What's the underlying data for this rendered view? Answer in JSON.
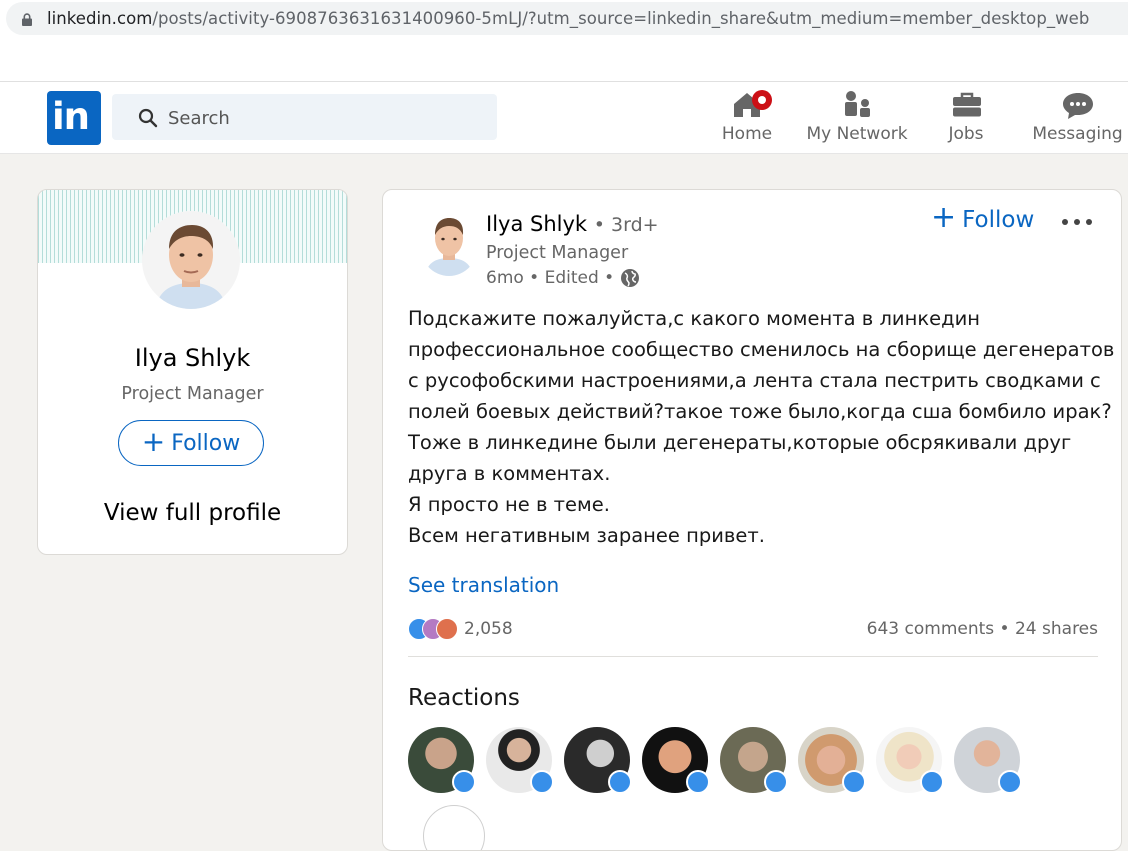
{
  "browser": {
    "url_host": "linkedin.com",
    "url_rest": "/posts/activity-6908763631631400960-5mLJ/?utm_source=linkedin_share&utm_medium=member_desktop_web"
  },
  "header": {
    "logo_text": "in",
    "search_placeholder": "Search",
    "nav": [
      {
        "label": "Home",
        "icon": "home-icon"
      },
      {
        "label": "My Network",
        "icon": "network-icon"
      },
      {
        "label": "Jobs",
        "icon": "briefcase-icon"
      },
      {
        "label": "Messaging",
        "icon": "messaging-icon"
      }
    ]
  },
  "profile": {
    "name": "Ilya Shlyk",
    "title": "Project Manager",
    "follow_label": "Follow",
    "view_profile_label": "View full profile"
  },
  "post": {
    "author": "Ilya Shlyk",
    "degree": "• 3rd+",
    "headline": "Project Manager",
    "meta": "6mo • Edited •",
    "follow_label": "Follow",
    "body_lines": [
      "Подскажите пожалуйста,с какого момента в линкедин",
      "профессиональное сообщество сменилось на сборище дегенератов",
      "с русофобскими настроениями,а лента стала пестрить сводками с",
      "полей боевых действий?такое тоже было,когда сша бомбило ирак?",
      "Тоже в линкедине были дегенераты,которые обсрякивали друг",
      "друга в комментах.",
      "Я просто не в теме.",
      "Всем негативным заранее привет."
    ],
    "see_translation": "See translation",
    "reaction_count": "2,058",
    "comments_shares": "643 comments • 24 shares",
    "reactions_heading": "Reactions"
  },
  "colors": {
    "brand": "#0a66c2",
    "notification": "#cc1016",
    "like": "#378fe9"
  }
}
